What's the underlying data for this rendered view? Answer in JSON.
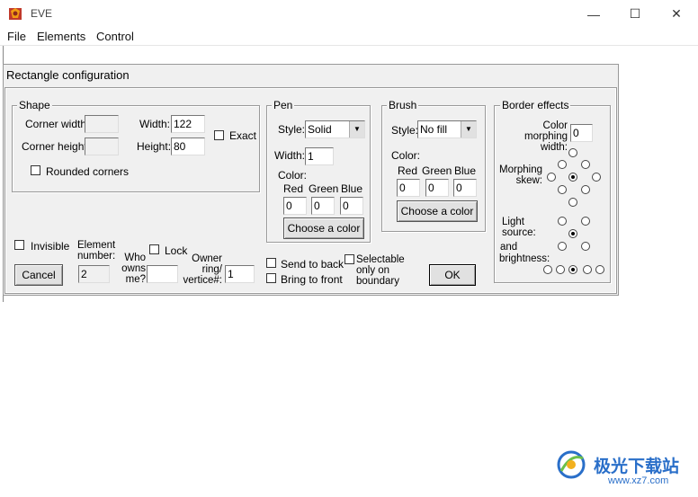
{
  "window": {
    "title": "EVE",
    "minimize": "—",
    "maximize": "☐",
    "close": "✕"
  },
  "menu": [
    "File",
    "Elements",
    "Control"
  ],
  "dialog": {
    "title": "Rectangle configuration",
    "shape": {
      "label": "Shape",
      "corner_width_label": "Corner width:",
      "corner_width": "",
      "corner_height_label": "Corner height:",
      "corner_height": "",
      "width_label": "Width:",
      "width": "122",
      "height_label": "Height:",
      "height": "80",
      "exact_label": "Exact",
      "rounded_label": "Rounded corners"
    },
    "pen": {
      "label": "Pen",
      "style_label": "Style:",
      "style": "Solid",
      "width_label": "Width:",
      "width": "1",
      "color_label": "Color:",
      "red_label": "Red",
      "green_label": "Green",
      "blue_label": "Blue",
      "red": "0",
      "green": "0",
      "blue": "0",
      "choose_label": "Choose a color"
    },
    "brush": {
      "label": "Brush",
      "style_label": "Style:",
      "style": "No fill",
      "color_label": "Color:",
      "red_label": "Red",
      "green_label": "Green",
      "blue_label": "Blue",
      "red": "0",
      "green": "0",
      "blue": "0",
      "choose_label": "Choose a color"
    },
    "border": {
      "label": "Border effects",
      "morph_width_label": "Color morphing width:",
      "morph_width": "0",
      "morph_skew_label": "Morphing skew:",
      "light_label": "Light source:",
      "and_label": "and",
      "brightness_label": "brightness:"
    },
    "bottom": {
      "invisible_label": "Invisible",
      "element_number_label": "Element number:",
      "element_number": "2",
      "who_owns_label": "Who owns me?",
      "who_owns": "",
      "lock_label": "Lock",
      "owner_ring_label": "Owner ring/ vertice#:",
      "owner_ring": "1",
      "send_back_label": "Send to back",
      "bring_front_label": "Bring to front",
      "selectable_label": "Selectable only on boundary",
      "cancel_label": "Cancel",
      "ok_label": "OK"
    }
  },
  "watermark": {
    "cn": "极光下载站",
    "url": "www.xz7.com"
  }
}
